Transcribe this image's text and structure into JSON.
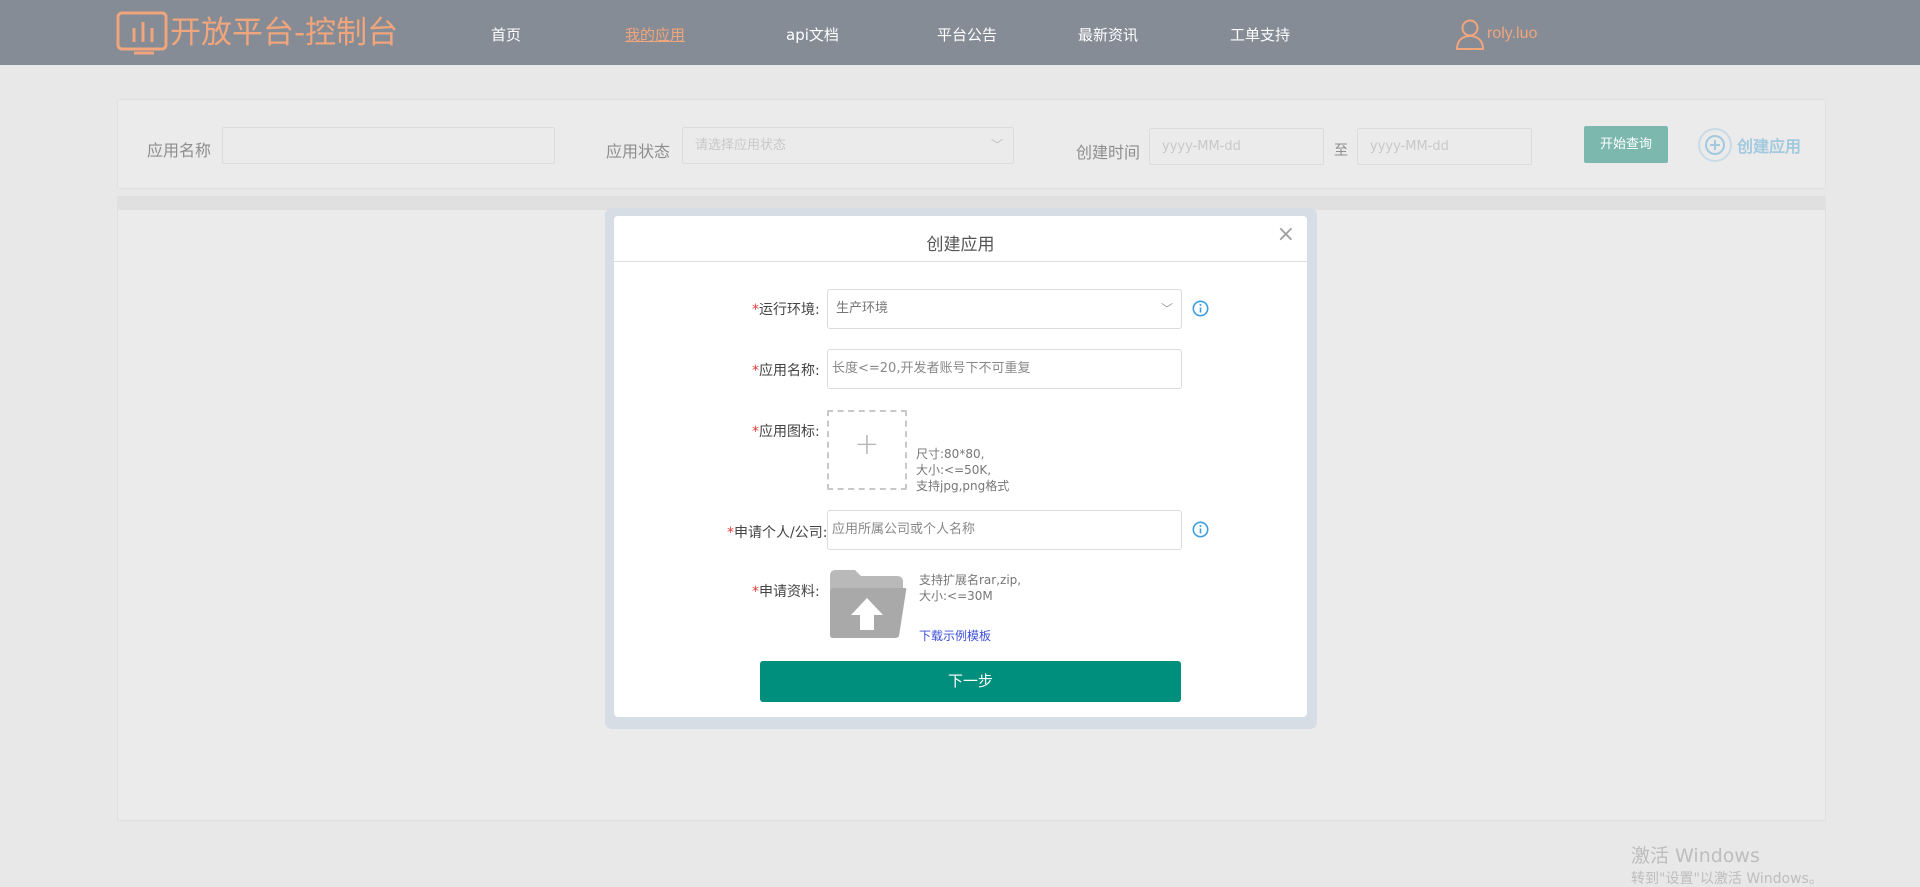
{
  "header": {
    "logo_text": "开放平台-控制台",
    "nav": [
      {
        "label": "首页",
        "active": false
      },
      {
        "label": "我的应用",
        "active": true
      },
      {
        "label": "api文档",
        "active": false
      },
      {
        "label": "平台公告",
        "active": false
      },
      {
        "label": "最新资讯",
        "active": false
      },
      {
        "label": "工单支持",
        "active": false
      }
    ],
    "username": "roly.luo"
  },
  "filter": {
    "app_name_label": "应用名称",
    "app_name_value": "",
    "app_status_label": "应用状态",
    "app_status_placeholder": "请选择应用状态",
    "created_label": "创建时间",
    "date_from_placeholder": "yyyy-MM-dd",
    "date_to_label": "至",
    "date_to_placeholder": "yyyy-MM-dd",
    "query_button": "开始查询",
    "create_button": "创建应用"
  },
  "modal": {
    "title": "创建应用",
    "close_symbol": "×",
    "required_mark": "*",
    "env_label": "运行环境:",
    "env_value": "生产环境",
    "name_label": "应用名称:",
    "name_placeholder": "长度<=20,开发者账号下不可重复",
    "icon_label": "应用图标:",
    "icon_plus": "+",
    "icon_hints": [
      "尺寸:80*80,",
      "大小:<=50K,",
      "支持jpg,png格式"
    ],
    "applicant_label": "申请个人/公司:",
    "applicant_placeholder": "应用所属公司或个人名称",
    "material_label": "申请资料:",
    "material_hints": [
      "支持扩展名rar,zip,",
      "大小:<=30M"
    ],
    "download_template": "下载示例模板",
    "next_button": "下一步"
  },
  "watermark": {
    "line1": "激活 Windows",
    "line2": "转到\"设置\"以激活 Windows。"
  },
  "colors": {
    "topbar": "#858c95",
    "brand_orange": "#f0a57c",
    "primary_green": "#018f7d",
    "required_red": "#e03c3c",
    "link_blue": "#3d4fd9"
  }
}
